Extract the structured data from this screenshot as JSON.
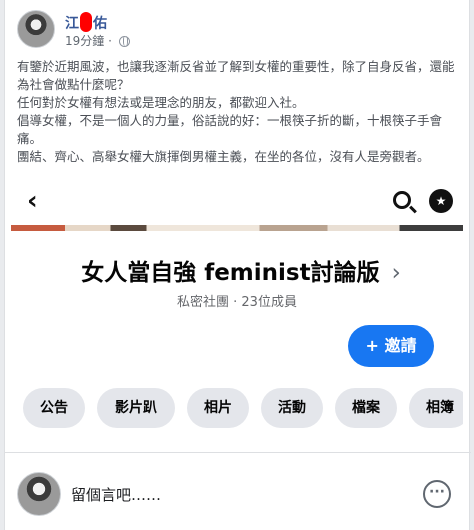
{
  "post": {
    "author": {
      "name_first": "江",
      "name_last": "佑",
      "name_redacted": true
    },
    "time": "19分鐘",
    "privacy_icon": "globe-icon",
    "paragraphs": [
      "有鑒於近期風波，也讓我逐漸反省並了解到女權的重要性，除了自身反省，還能為社會做點什麼呢？",
      "任何對於女權有想法或是理念的朋友，都歡迎入社。",
      "倡導女權，不是一個人的力量，俗話說的好：一根筷子折的斷，十根筷子手會痛。",
      "團結、齊心、高舉女權大旗揮倒男權主義，在坐的各位，沒有人是旁觀者。"
    ]
  },
  "screenshot": {
    "nav": {
      "back_icon": "back-arrow-icon",
      "search_icon": "search-icon",
      "shield_icon": "shield-icon"
    },
    "group_name": "女人當自強 feminist討論版",
    "group_chevron": "›",
    "group_meta": "私密社團 · 23位成員",
    "invite_label": "+ 邀請",
    "tabs": [
      {
        "label": "公告"
      },
      {
        "label": "影片趴"
      },
      {
        "label": "相片"
      },
      {
        "label": "活動"
      },
      {
        "label": "檔案"
      },
      {
        "label": "相簿"
      }
    ]
  },
  "comment_bar": {
    "placeholder": "留個言吧……",
    "more_icon": "more-options-icon"
  },
  "colors": {
    "link": "#385898",
    "accent": "#1877f2",
    "redaction": "#ff0000"
  }
}
